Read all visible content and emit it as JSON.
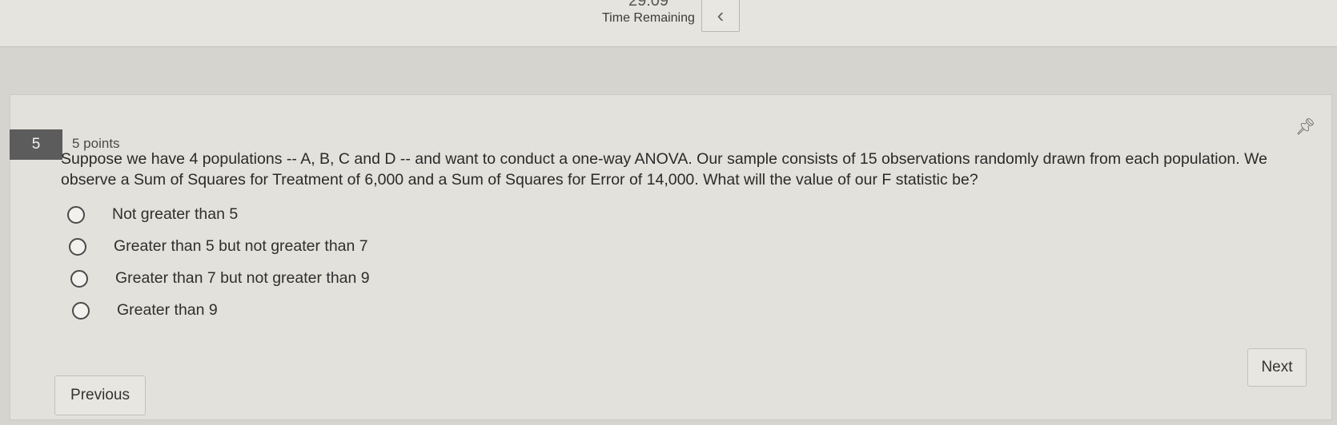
{
  "header": {
    "timer_value": "29:09",
    "timer_label": "Time Remaining",
    "collapse_icon": "chevron-left-icon"
  },
  "question": {
    "number": "5",
    "points": "5 points",
    "text": "Suppose we have 4 populations -- A, B, C and D -- and want to conduct a one-way ANOVA. Our sample consists of 15 observations randomly drawn from each population. We observe a Sum of Squares for Treatment of 6,000 and a Sum of Squares for Error of 14,000. What will the value of our F statistic be?",
    "pin_icon": "pin-icon",
    "options": [
      {
        "label": "Not greater than 5"
      },
      {
        "label": "Greater than 5 but not greater than 7"
      },
      {
        "label": "Greater than 7 but not greater than 9"
      },
      {
        "label": "Greater than 9"
      }
    ]
  },
  "navigation": {
    "previous_label": "Previous",
    "next_label": "Next"
  }
}
